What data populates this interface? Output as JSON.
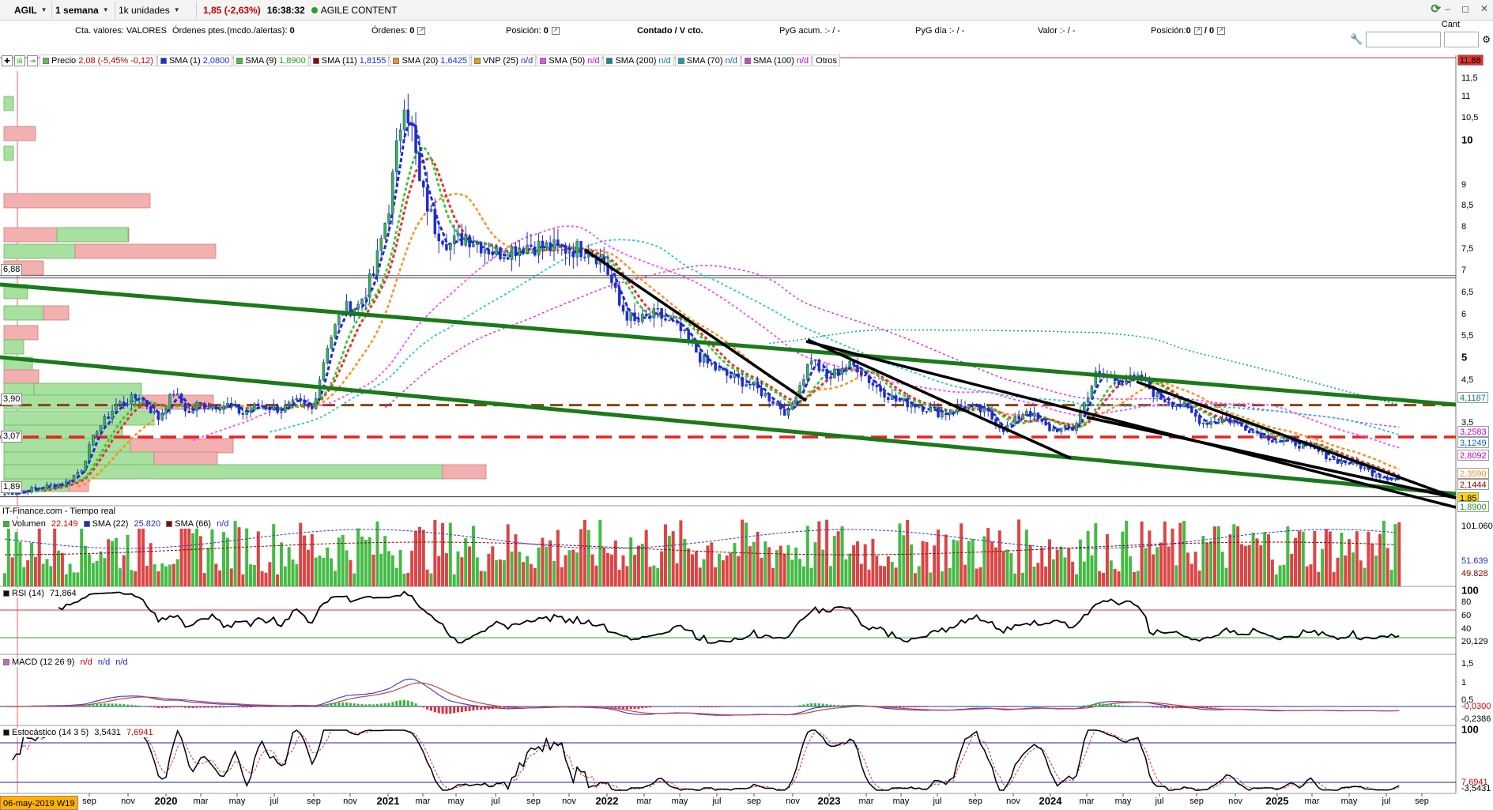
{
  "toolbar": {
    "symbol": "AGIL",
    "period": "1 semana",
    "units": "1k unidades",
    "price_change": "1,85 (-2,63%)",
    "time": "16:38:32",
    "company": "AGILE CONTENT"
  },
  "status": {
    "cta": "Cta. valores:",
    "cta_value": "VALORES",
    "ordenes_ptes": "Órdenes ptes.(mcdo./alertas):",
    "ordenes_ptes_value": "0",
    "ordenes": "Órdenes:",
    "ordenes_value": "0",
    "posicion": "Posición:",
    "posicion_value": "0",
    "contado": "Contado / V cto.",
    "pyg_acum": "PyG acum. :- / -",
    "pyg_dia": "PyG día :- / -",
    "valor": "Valor :- / -",
    "posicion2": "Posición:",
    "posicion2_value": "0",
    "posicion2_b": "/ 0",
    "cant": "Cant"
  },
  "legend": [
    {
      "name": "Precio",
      "value": "2,08 (-5,45% -0,12)",
      "color": "#5fbf5f",
      "vcolor": "#c00000"
    },
    {
      "name": "SMA (1)",
      "value": "2,0800",
      "color": "#1f2bd0",
      "vcolor": "#1f2bd0"
    },
    {
      "name": "SMA (9)",
      "value": "1,8900",
      "color": "#33cc33",
      "vcolor": "#229922"
    },
    {
      "name": "SMA (11)",
      "value": "1,8155",
      "color": "#8b0000",
      "vcolor": "#1f2bd0"
    },
    {
      "name": "SMA (20)",
      "value": "1,6425",
      "color": "#ff9020",
      "vcolor": "#1f2bd0"
    },
    {
      "name": "VNP (25)",
      "value": "n/d",
      "color": "#e8a000",
      "vcolor": "#1f2bd0"
    },
    {
      "name": "SMA (50)",
      "value": "n/d",
      "color": "#ff44ff",
      "vcolor": "#cc00cc"
    },
    {
      "name": "SMA (200)",
      "value": "n/d",
      "color": "#009090",
      "vcolor": "#008080"
    },
    {
      "name": "SMA (70)",
      "value": "n/d",
      "color": "#00aaaa",
      "vcolor": "#0066aa"
    },
    {
      "name": "SMA (100)",
      "value": "n/d",
      "color": "#cc44cc",
      "vcolor": "#cc00cc"
    },
    {
      "name": "Otros",
      "value": "",
      "color": "",
      "vcolor": "#000"
    }
  ],
  "colors": {
    "up": "#33bb33",
    "down": "#e03030",
    "green_trend": "#1a7a1a",
    "red_level": "#ee2020",
    "brown_level": "#8b4513",
    "candle": "#1f2bd0"
  },
  "price_axis": {
    "labels": [
      "11,5",
      "11",
      "10,5",
      "10",
      "9",
      "8,5",
      "8",
      "7,5",
      "7",
      "6,5",
      "6",
      "5,5",
      "5",
      "4,5",
      "4",
      "3,5",
      "3"
    ],
    "bold": [
      "10",
      "5"
    ],
    "tags": [
      {
        "text": "11,88",
        "bg": "#e03030",
        "fg": "#000"
      },
      {
        "text": "4,1187",
        "bg": "#ffffff",
        "fg": "#008080"
      },
      {
        "text": "3,2583",
        "bg": "#ffffff",
        "fg": "#cc00cc"
      },
      {
        "text": "3,1249",
        "bg": "#ffffff",
        "fg": "#0066aa"
      },
      {
        "text": "2,8092",
        "bg": "#ffffff",
        "fg": "#cc00cc"
      },
      {
        "text": "2,3590",
        "bg": "#ffffff",
        "fg": "#ff9020"
      },
      {
        "text": "2,1444",
        "bg": "#ffffff",
        "fg": "#8b0000"
      },
      {
        "text": "1,85",
        "bg": "#ffd700",
        "fg": "#000"
      },
      {
        "text": "1,8900",
        "bg": "#ffffff",
        "fg": "#229922"
      }
    ]
  },
  "profile_tags": [
    "6,88",
    "3,90",
    "3,07",
    "1,89"
  ],
  "credit": "IT-Finance.com - Tiempo real",
  "volume": {
    "label": "Volumen",
    "value": "22.149",
    "sma22": "SMA (22)",
    "sma22_value": "25.820",
    "sma66": "SMA (66)",
    "sma66_value": "n/d",
    "axis": [
      "101.060",
      "51.639",
      "49.828"
    ]
  },
  "rsi": {
    "label": "RSI (14)",
    "value": "71,864",
    "axis": [
      "100",
      "80",
      "60",
      "40",
      "20,129"
    ]
  },
  "macd": {
    "label": "MACD (12 26 9)",
    "values": [
      "n/d",
      "n/d",
      "n/d"
    ],
    "axis": [
      "1,5",
      "1",
      "0,5",
      "-0,0300",
      "-0,2386"
    ]
  },
  "stoch": {
    "label": "Estocástico (14 3 5)",
    "value1": "3,5431",
    "value2": "7,6941",
    "axis": [
      "100",
      "7,6941",
      "-3,5431"
    ]
  },
  "x_axis": [
    "sep",
    "nov",
    "2020",
    "mar",
    "may",
    "jul",
    "sep",
    "nov",
    "2021",
    "mar",
    "may",
    "jul",
    "sep",
    "nov",
    "2022",
    "mar",
    "may",
    "jul",
    "sep",
    "nov",
    "2023",
    "mar",
    "may",
    "jul",
    "sep",
    "nov",
    "2024",
    "mar",
    "may",
    "jul",
    "sep",
    "nov",
    "2025",
    "mar",
    "may",
    "jul",
    "sep"
  ],
  "date_badge": "06-may-2019 W19",
  "chart_data": {
    "type": "line",
    "series": [
      {
        "name": "Precio",
        "anchors": [
          [
            0,
            1.75
          ],
          [
            8,
            1.86
          ],
          [
            16,
            2.0
          ],
          [
            20,
            2.3
          ],
          [
            24,
            3.3
          ],
          [
            29,
            3.9
          ],
          [
            35,
            4.1
          ],
          [
            40,
            3.6
          ],
          [
            44,
            4.2
          ],
          [
            48,
            3.7
          ],
          [
            50,
            3.9
          ],
          [
            58,
            3.9
          ],
          [
            62,
            3.7
          ],
          [
            66,
            3.9
          ],
          [
            72,
            3.8
          ],
          [
            76,
            3.95
          ],
          [
            80,
            3.8
          ],
          [
            84,
            5.3
          ],
          [
            88,
            6.1
          ],
          [
            92,
            6.2
          ],
          [
            96,
            6.9
          ],
          [
            100,
            8.5
          ],
          [
            104,
            11.0
          ],
          [
            106,
            10.2
          ],
          [
            108,
            9.0
          ],
          [
            112,
            8.0
          ],
          [
            116,
            7.6
          ],
          [
            120,
            7.8
          ],
          [
            128,
            7.4
          ],
          [
            136,
            7.6
          ],
          [
            144,
            7.5
          ],
          [
            152,
            7.5
          ],
          [
            156,
            7.2
          ],
          [
            160,
            6.2
          ],
          [
            164,
            5.8
          ],
          [
            170,
            6.0
          ],
          [
            176,
            5.6
          ],
          [
            182,
            4.9
          ],
          [
            188,
            4.6
          ],
          [
            194,
            4.4
          ],
          [
            200,
            4.0
          ],
          [
            204,
            3.7
          ],
          [
            206,
            4.2
          ],
          [
            210,
            5.0
          ],
          [
            214,
            4.5
          ],
          [
            218,
            4.8
          ],
          [
            222,
            4.8
          ],
          [
            226,
            4.4
          ],
          [
            232,
            4.0
          ],
          [
            238,
            3.9
          ],
          [
            244,
            3.7
          ],
          [
            250,
            3.9
          ],
          [
            256,
            3.7
          ],
          [
            260,
            3.3
          ],
          [
            266,
            3.8
          ],
          [
            272,
            3.3
          ],
          [
            278,
            3.3
          ],
          [
            284,
            4.6
          ],
          [
            290,
            4.5
          ],
          [
            296,
            4.5
          ],
          [
            300,
            4.1
          ],
          [
            306,
            3.9
          ],
          [
            312,
            3.5
          ],
          [
            318,
            3.6
          ],
          [
            324,
            3.3
          ],
          [
            330,
            3.0
          ],
          [
            336,
            2.9
          ],
          [
            342,
            2.7
          ],
          [
            346,
            2.5
          ],
          [
            352,
            2.4
          ],
          [
            356,
            2.2
          ],
          [
            360,
            2.1
          ],
          [
            363,
            2.08
          ]
        ]
      }
    ]
  }
}
